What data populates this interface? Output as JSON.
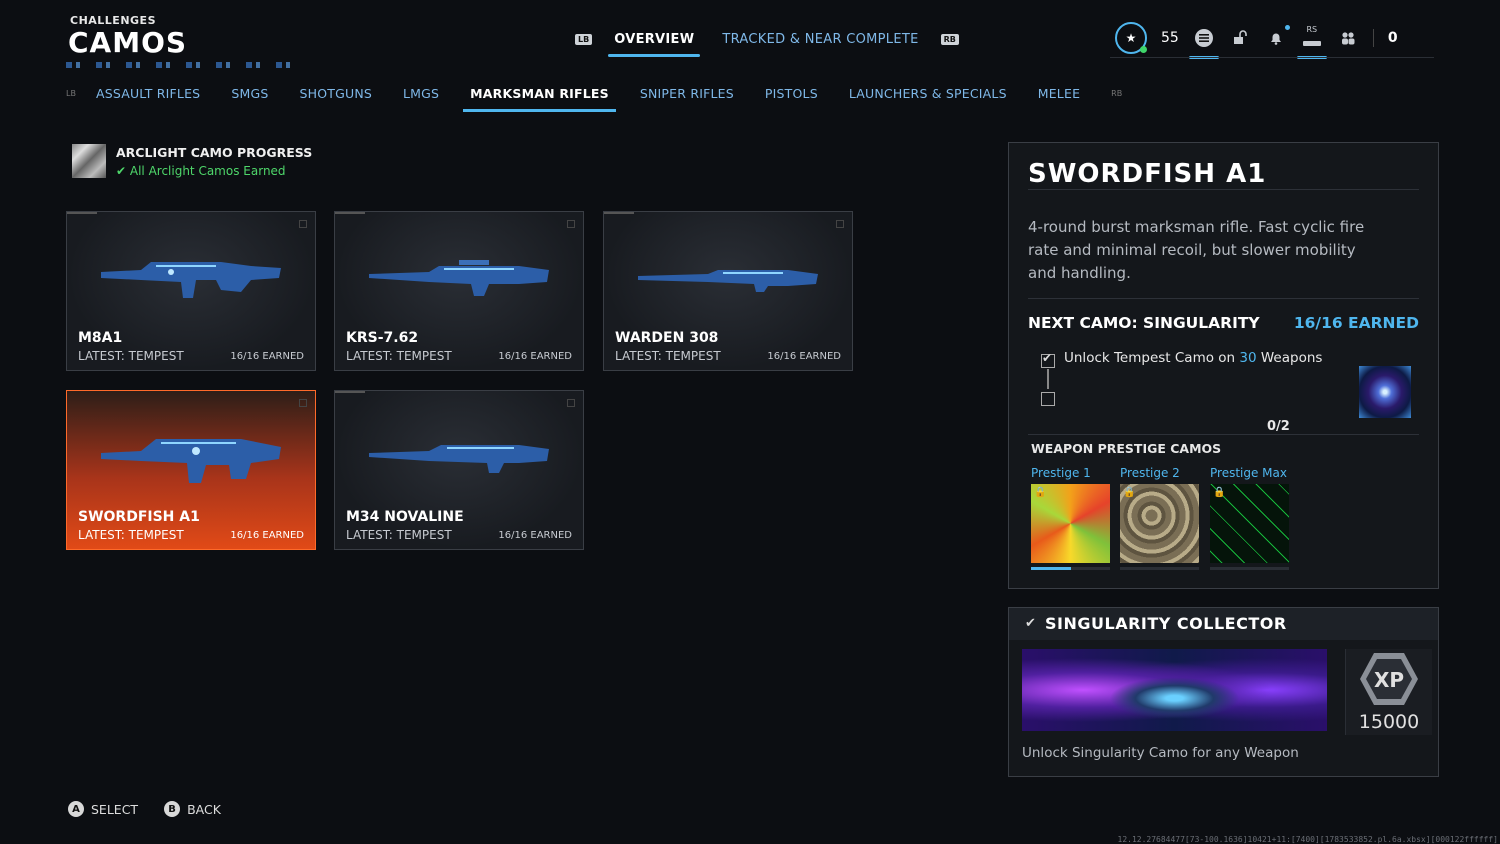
{
  "header": {
    "small": "CHALLENGES",
    "title": "CAMOS"
  },
  "topnav": {
    "lb": "LB",
    "rb": "RB",
    "tabs": [
      {
        "label": "OVERVIEW"
      },
      {
        "label": "TRACKED & NEAR COMPLETE"
      }
    ]
  },
  "status": {
    "level": "55",
    "currency": "0",
    "rs": "RS"
  },
  "categories": {
    "lb": "LB",
    "rb": "RB",
    "items": [
      "ASSAULT RIFLES",
      "SMGS",
      "SHOTGUNS",
      "LMGS",
      "MARKSMAN RIFLES",
      "SNIPER RIFLES",
      "PISTOLS",
      "LAUNCHERS & SPECIALS",
      "MELEE"
    ]
  },
  "arclight": {
    "title": "ARCLIGHT CAMO PROGRESS",
    "status": "All Arclight Camos Earned"
  },
  "weapons": [
    {
      "name": "M8A1",
      "latest": "LATEST: TEMPEST",
      "earned": "16/16 EARNED"
    },
    {
      "name": "KRS-7.62",
      "latest": "LATEST: TEMPEST",
      "earned": "16/16 EARNED"
    },
    {
      "name": "WARDEN 308",
      "latest": "LATEST: TEMPEST",
      "earned": "16/16 EARNED"
    },
    {
      "name": "SWORDFISH A1",
      "latest": "LATEST: TEMPEST",
      "earned": "16/16 EARNED"
    },
    {
      "name": "M34 NOVALINE",
      "latest": "LATEST: TEMPEST",
      "earned": "16/16 EARNED"
    }
  ],
  "detail": {
    "title": "SWORDFISH A1",
    "description": "4-round burst marksman rifle. Fast cyclic fire rate and minimal recoil, but slower mobility and handling.",
    "next_camo": "NEXT CAMO: SINGULARITY",
    "next_earned": "16/16 EARNED",
    "task_prefix": "Unlock Tempest Camo on ",
    "task_count": "30",
    "task_suffix": " Weapons",
    "progress": "0/2",
    "prestige_title": "WEAPON PRESTIGE CAMOS",
    "prestige": [
      {
        "label": "Prestige 1"
      },
      {
        "label": "Prestige 2"
      },
      {
        "label": "Prestige Max"
      }
    ]
  },
  "collector": {
    "title": "SINGULARITY COLLECTOR",
    "xp_label": "XP",
    "xp": "15000",
    "description": "Unlock Singularity Camo for any Weapon"
  },
  "footer": {
    "select_btn": "A",
    "select": "SELECT",
    "back_btn": "B",
    "back": "BACK"
  },
  "build": "12.12.27684477[73-100.1636]10421+11:[7400][1783533852.pl.6a.xbsx][000122ffffff]",
  "colors": {
    "accent": "#4fb6ee",
    "selected": "#e14a17",
    "earned_green": "#4ed66a"
  }
}
